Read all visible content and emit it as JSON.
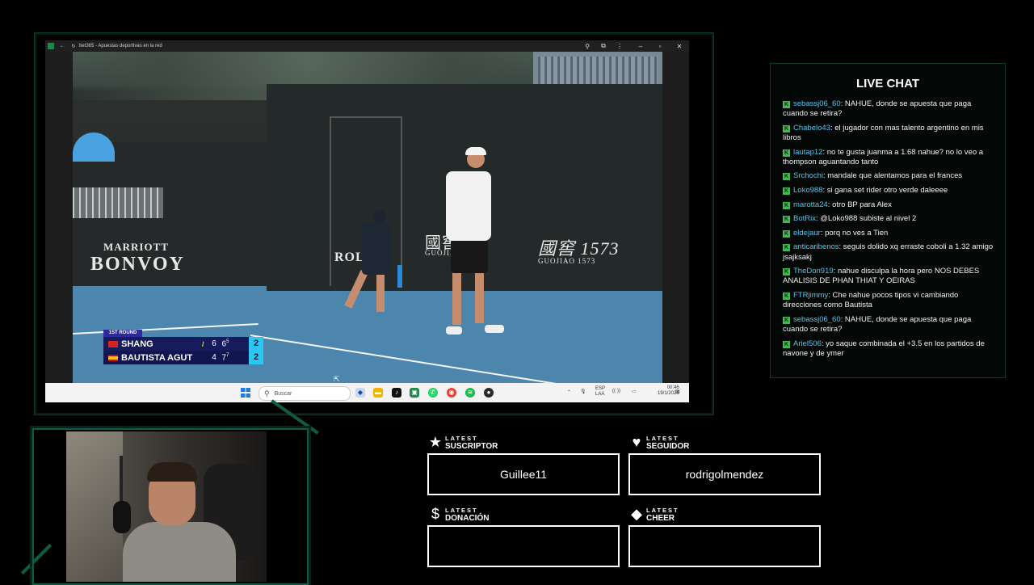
{
  "browser": {
    "tab_title": "bet365 - Apuestas deportivas en la red"
  },
  "video": {
    "sponsors": {
      "marriott": "MARRIOTT",
      "bonvoy": "BONVOY",
      "rolex": "ROLEX",
      "brand1": "國窖",
      "brand1_sub": "GUOJIAO",
      "brand2": "國窖 1573",
      "brand2_sub": "GUOJIAO 1573"
    },
    "scoreboard": {
      "round": "1ST ROUND",
      "players": [
        {
          "name": "SHANG",
          "set1": "6",
          "set2": "6",
          "set2_sup": "5",
          "points": "2",
          "serving": true
        },
        {
          "name": "BAUTISTA AGUT",
          "set1": "4",
          "set2": "7",
          "set2_sup": "7",
          "points": "2",
          "serving": false
        }
      ]
    }
  },
  "taskbar": {
    "search_placeholder": "Buscar",
    "lang1": "ESP",
    "lang2": "LAA",
    "time": "00:46",
    "date": "19/1/2026"
  },
  "chat": {
    "title": "LIVE CHAT",
    "badge_letter": "K",
    "messages": [
      {
        "user": "sebassj06_60",
        "text": "NAHUE, donde se apuesta que paga cuando se retira?"
      },
      {
        "user": "Chabelo43",
        "text": "el jugador con mas talento argentino en mis libros"
      },
      {
        "user": "lautap12",
        "text": "no te gusta juanma a 1.68 nahue? no lo veo a thompson aguantando tanto"
      },
      {
        "user": "Srchochi",
        "text": "mandale que alentamos para el frances"
      },
      {
        "user": "Loko988",
        "text": "si gana set rider otro verde daleeee"
      },
      {
        "user": "marotta24",
        "text": "otro BP para Alex"
      },
      {
        "user": "BotRix",
        "text": "@Loko988 subiste al nivel 2"
      },
      {
        "user": "eldejaur",
        "text": "porq no ves a Tien"
      },
      {
        "user": "anticaribenos",
        "text": "seguis dolido xq erraste coboli a 1.32 amigo jsajksakj"
      },
      {
        "user": "TheDon919",
        "text": "nahue disculpa la hora pero NOS DEBES ANALISIS DE PHAN THIAT Y OEIRAS"
      },
      {
        "user": "FTRjimmy",
        "text": "Che nahue pocos tipos vi cambiando direcciones como Bautista"
      },
      {
        "user": "sebassj06_60",
        "text": "NAHUE, donde se apuesta que paga cuando se retira?"
      },
      {
        "user": "Ariel506",
        "text": "yo saque combinada el +3.5 en los partidos de navone y de ymer"
      }
    ]
  },
  "alerts": {
    "suscriptor": {
      "small": "LATEST",
      "big": "SUSCRIPTOR",
      "value": "Guillee11"
    },
    "seguidor": {
      "small": "LATEST",
      "big": "SEGUIDOR",
      "value": "rodrigolmendez"
    },
    "donacion": {
      "small": "LATEST",
      "big": "DONACIÓN",
      "value": ""
    },
    "cheer": {
      "small": "LATEST",
      "big": "CHEER",
      "value": ""
    }
  }
}
